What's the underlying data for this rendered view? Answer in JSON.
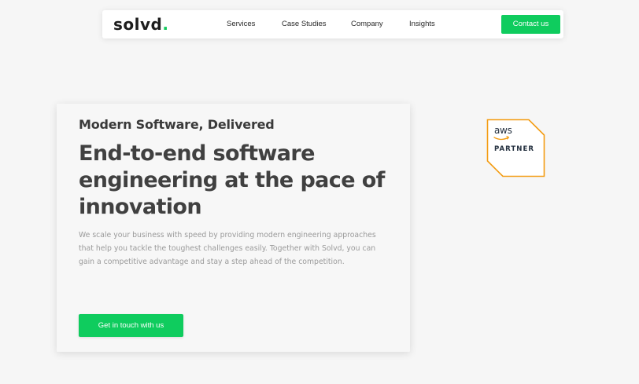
{
  "nav": {
    "logo_text": "solvd",
    "logo_dot": ".",
    "links": [
      "Services",
      "Case Studies",
      "Company",
      "Insights"
    ],
    "contact_label": "Contact us"
  },
  "hero": {
    "eyebrow": "Modern Software, Delivered",
    "title": "End-to-end software engineering at the pace of innovation",
    "description": "We scale your business with speed by providing modern engineering approaches that help you tackle the toughest challenges easily. Together with Solvd, you can gain a competitive advantage and stay a step ahead of the competition.",
    "cta_label": "Get in touch with us"
  },
  "badge": {
    "aws_text": "aws",
    "partner_text": "PARTNER"
  },
  "colors": {
    "accent": "#0fcc5e",
    "page_background": "#f6f6f6",
    "badge_orange": "#f39c12",
    "aws_navy": "#232f3e"
  },
  "icons": [
    "aws-smile-icon",
    "aws-partner-badge-icon"
  ]
}
